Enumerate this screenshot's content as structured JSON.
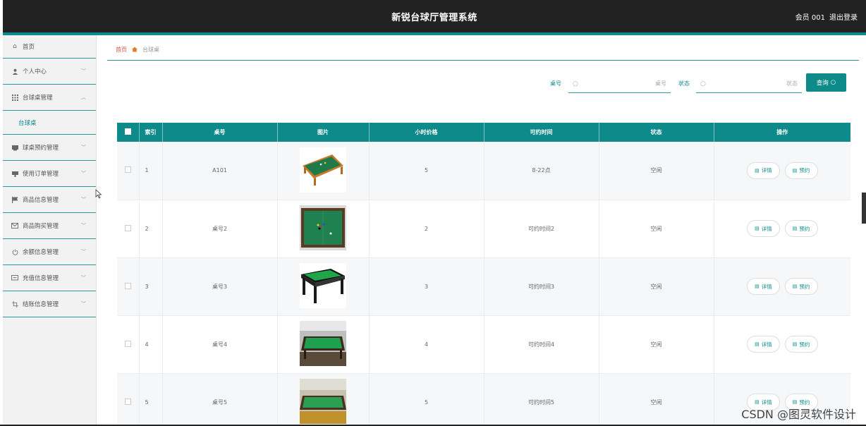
{
  "header": {
    "title": "新锐台球厅管理系统",
    "user": "会员 001",
    "logout": "退出登录"
  },
  "sidebar": {
    "items": [
      {
        "label": "首页",
        "icon": "home-icon"
      },
      {
        "label": "个人中心",
        "icon": "user-icon"
      },
      {
        "label": "台球桌管理",
        "icon": "grid-icon",
        "expanded": true,
        "sub": "台球桌"
      },
      {
        "label": "球桌预约管理",
        "icon": "calendar-icon"
      },
      {
        "label": "使用订单管理",
        "icon": "order-icon"
      },
      {
        "label": "商品信息管理",
        "icon": "flag-icon"
      },
      {
        "label": "商品购买管理",
        "icon": "mail-icon"
      },
      {
        "label": "余额信息管理",
        "icon": "power-icon"
      },
      {
        "label": "充值信息管理",
        "icon": "message-icon"
      },
      {
        "label": "结账信息管理",
        "icon": "crop-icon"
      }
    ]
  },
  "breadcrumb": {
    "home": "首页",
    "current": "台球桌"
  },
  "search": {
    "table_no_label": "桌号",
    "table_no_placeholder": "桌号",
    "status_label": "状态",
    "status_placeholder": "状态",
    "query_button": "查询"
  },
  "table": {
    "headers": [
      "索引",
      "桌号",
      "图片",
      "小时价格",
      "可约时间",
      "状态",
      "操作"
    ],
    "rows": [
      {
        "index": "1",
        "table_no": "A101",
        "price": "5",
        "time": "8-22点",
        "status": "空闲"
      },
      {
        "index": "2",
        "table_no": "桌号2",
        "price": "2",
        "time": "可约时间2",
        "status": "空闲"
      },
      {
        "index": "3",
        "table_no": "桌号3",
        "price": "3",
        "time": "可约时间3",
        "status": "空闲"
      },
      {
        "index": "4",
        "table_no": "桌号4",
        "price": "4",
        "time": "可约时间4",
        "status": "空闲"
      },
      {
        "index": "5",
        "table_no": "桌号5",
        "price": "5",
        "time": "可约时间5",
        "status": "空闲"
      }
    ],
    "detail_label": "详情",
    "reserve_label": "预约"
  },
  "watermark": "CSDN @图灵软件设计",
  "colors": {
    "accent": "#0f8a8a",
    "topbar": "#222222"
  }
}
